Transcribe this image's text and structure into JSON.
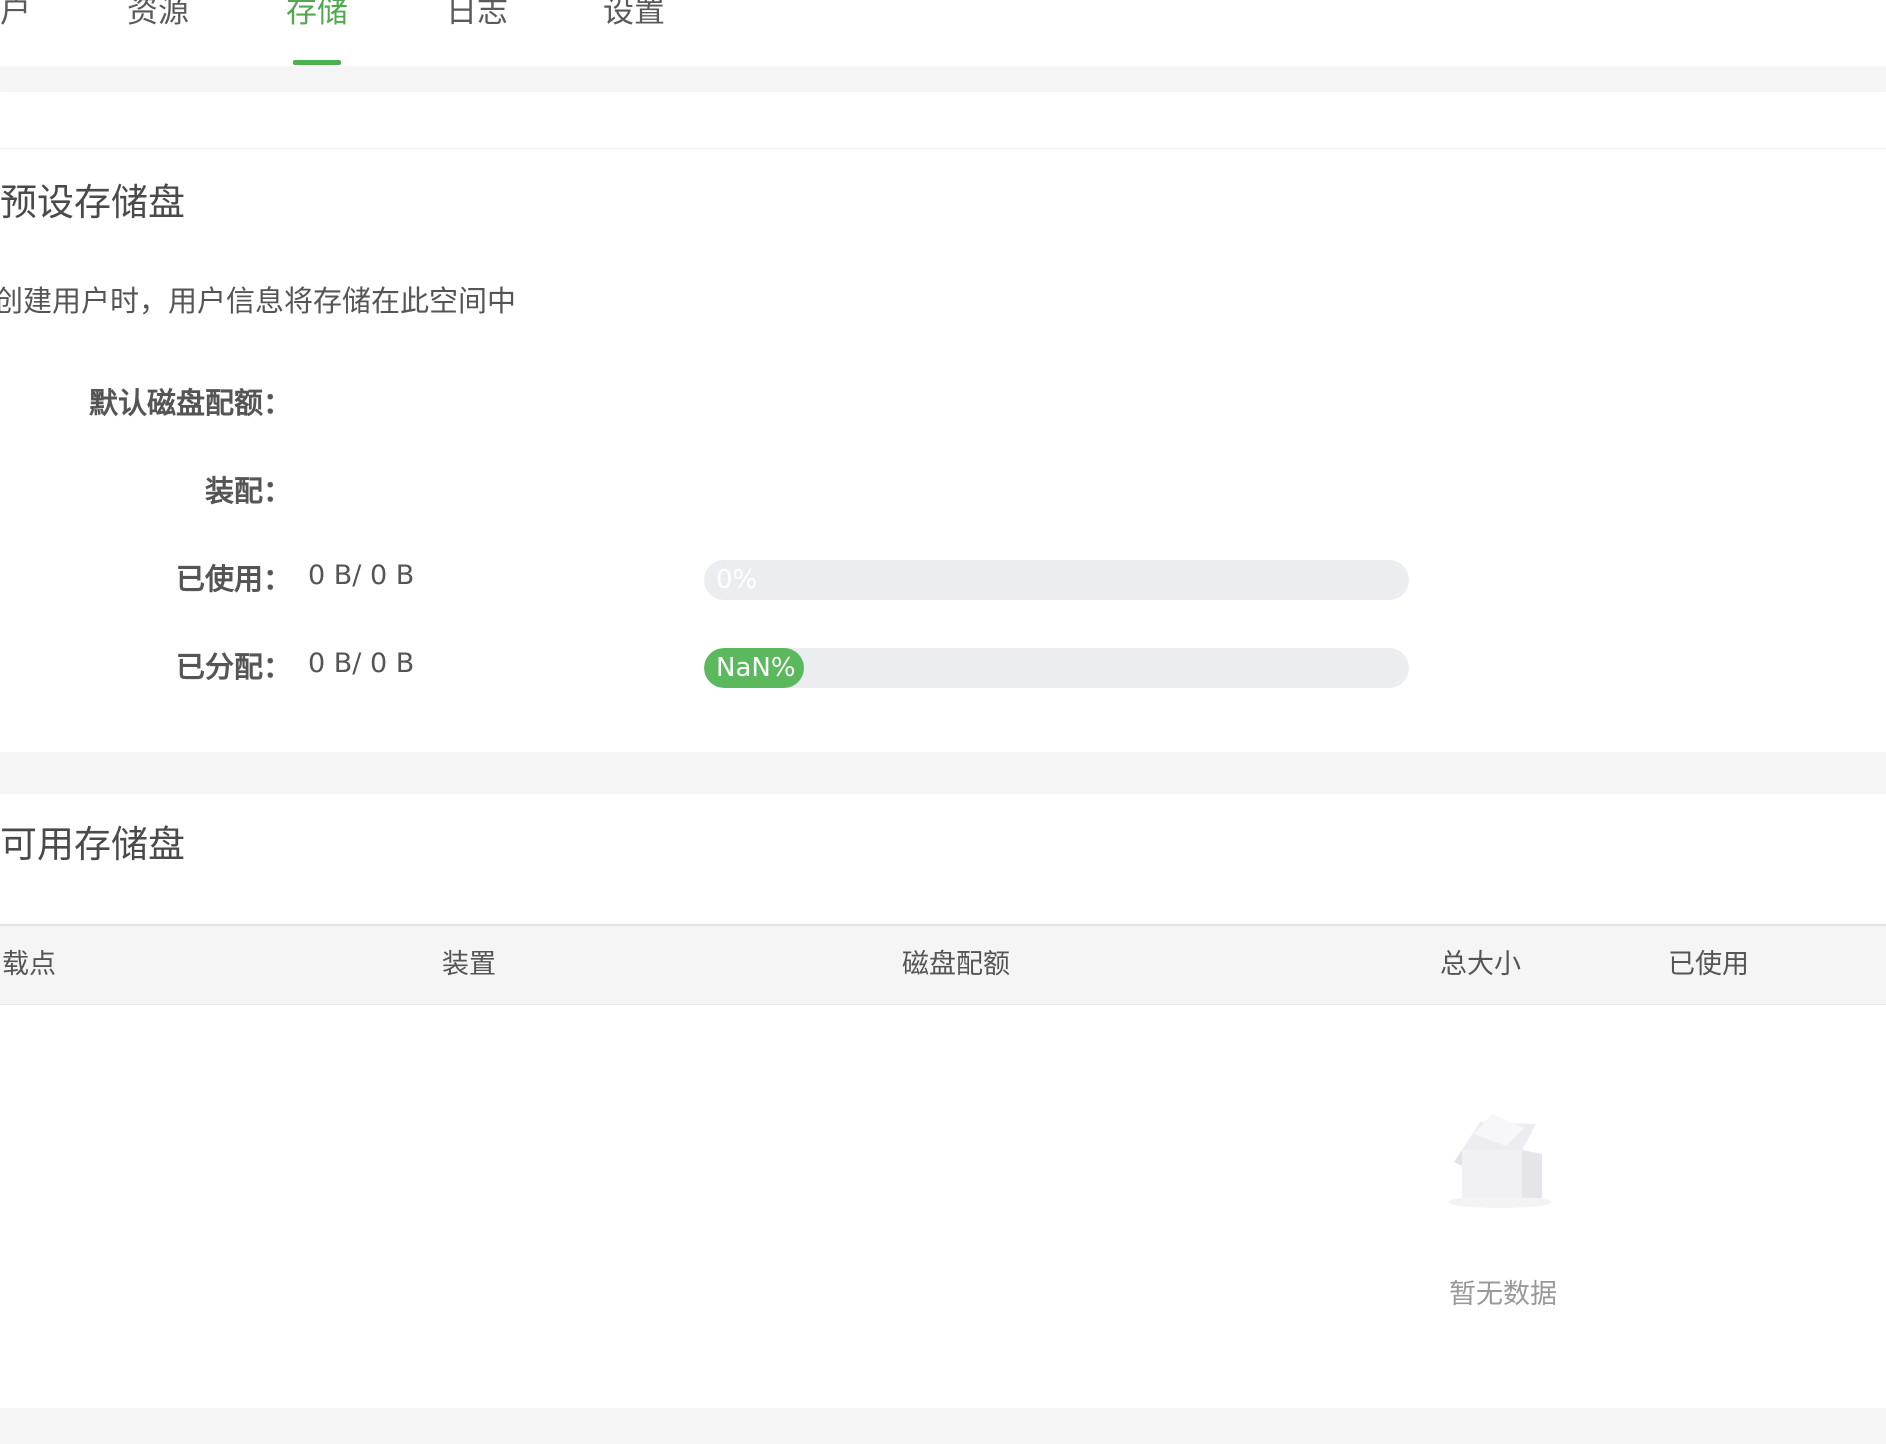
{
  "tabs": [
    {
      "label": "户",
      "active": false
    },
    {
      "label": "资源",
      "active": false
    },
    {
      "label": "存储",
      "active": true
    },
    {
      "label": "日志",
      "active": false
    },
    {
      "label": "设置",
      "active": false
    }
  ],
  "default_storage": {
    "title": "预设存储盘",
    "description": "创建用户时，用户信息将存储在此空间中",
    "fields": {
      "quota_label": "默认磁盘配额：",
      "device_label": "装配：",
      "used_label": "已使用：",
      "used_value": "0 B/ 0 B",
      "used_percent_text": "0%",
      "used_percent": 0,
      "allocated_label": "已分配：",
      "allocated_value": "0 B/ 0 B",
      "allocated_percent_text": "NaN%"
    }
  },
  "available_storage": {
    "title": "可用存储盘",
    "columns": [
      "载点",
      "装置",
      "磁盘配额",
      "总大小",
      "已使用"
    ],
    "rows": [],
    "empty_text": "暂无数据"
  },
  "colors": {
    "accent": "#4caf50",
    "progress_bg": "#ebedf0"
  },
  "icons": {
    "empty": "empty-box-icon"
  }
}
